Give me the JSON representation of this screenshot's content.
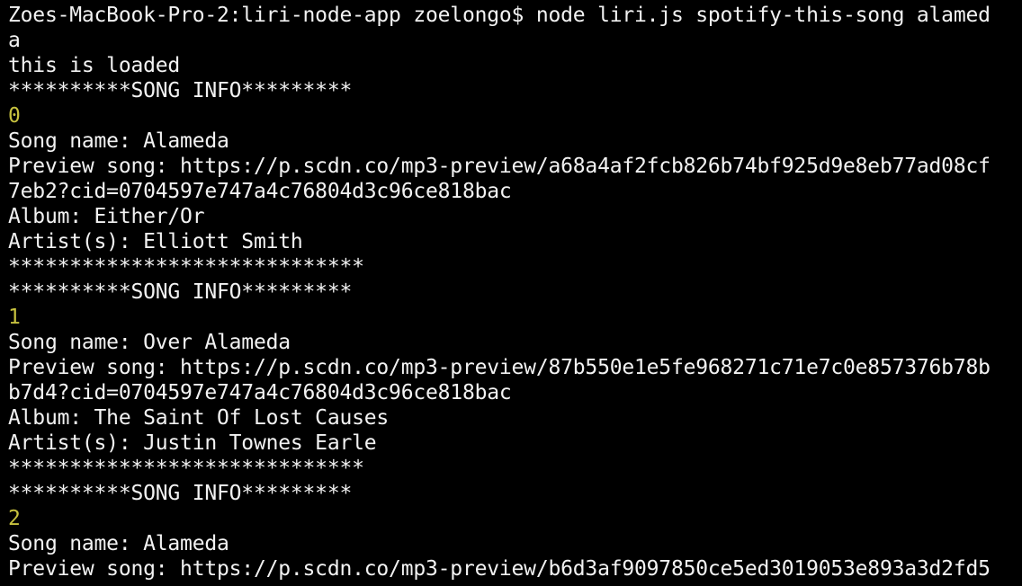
{
  "terminal": {
    "lines": [
      {
        "text": "Zoes-MacBook-Pro-2:liri-node-app zoelongo$ node liri.js spotify-this-song alamed",
        "kind": "prompt"
      },
      {
        "text": "a",
        "kind": "output"
      },
      {
        "text": "this is loaded",
        "kind": "output"
      },
      {
        "text": "**********SONG INFO*********",
        "kind": "output"
      },
      {
        "text": "0",
        "kind": "index"
      },
      {
        "text": "Song name: Alameda",
        "kind": "output"
      },
      {
        "text": "Preview song: https://p.scdn.co/mp3-preview/a68a4af2fcb826b74bf925d9e8eb77ad08cf",
        "kind": "output"
      },
      {
        "text": "7eb2?cid=0704597e747a4c76804d3c96ce818bac",
        "kind": "output"
      },
      {
        "text": "Album: Either/Or",
        "kind": "output"
      },
      {
        "text": "Artist(s): Elliott Smith",
        "kind": "output"
      },
      {
        "text": "*****************************",
        "kind": "output"
      },
      {
        "text": "**********SONG INFO*********",
        "kind": "output"
      },
      {
        "text": "1",
        "kind": "index"
      },
      {
        "text": "Song name: Over Alameda",
        "kind": "output"
      },
      {
        "text": "Preview song: https://p.scdn.co/mp3-preview/87b550e1e5fe968271c71e7c0e857376b78b",
        "kind": "output"
      },
      {
        "text": "b7d4?cid=0704597e747a4c76804d3c96ce818bac",
        "kind": "output"
      },
      {
        "text": "Album: The Saint Of Lost Causes",
        "kind": "output"
      },
      {
        "text": "Artist(s): Justin Townes Earle",
        "kind": "output"
      },
      {
        "text": "*****************************",
        "kind": "output"
      },
      {
        "text": "**********SONG INFO*********",
        "kind": "output"
      },
      {
        "text": "2",
        "kind": "index"
      },
      {
        "text": "Song name: Alameda",
        "kind": "output"
      },
      {
        "text": "Preview song: https://p.scdn.co/mp3-preview/b6d3af9097850ce5ed3019053e893a3d2fd5",
        "kind": "output"
      }
    ]
  },
  "colors": {
    "background": "#000000",
    "text": "#f2f2f2",
    "index": "#c7c23f"
  }
}
